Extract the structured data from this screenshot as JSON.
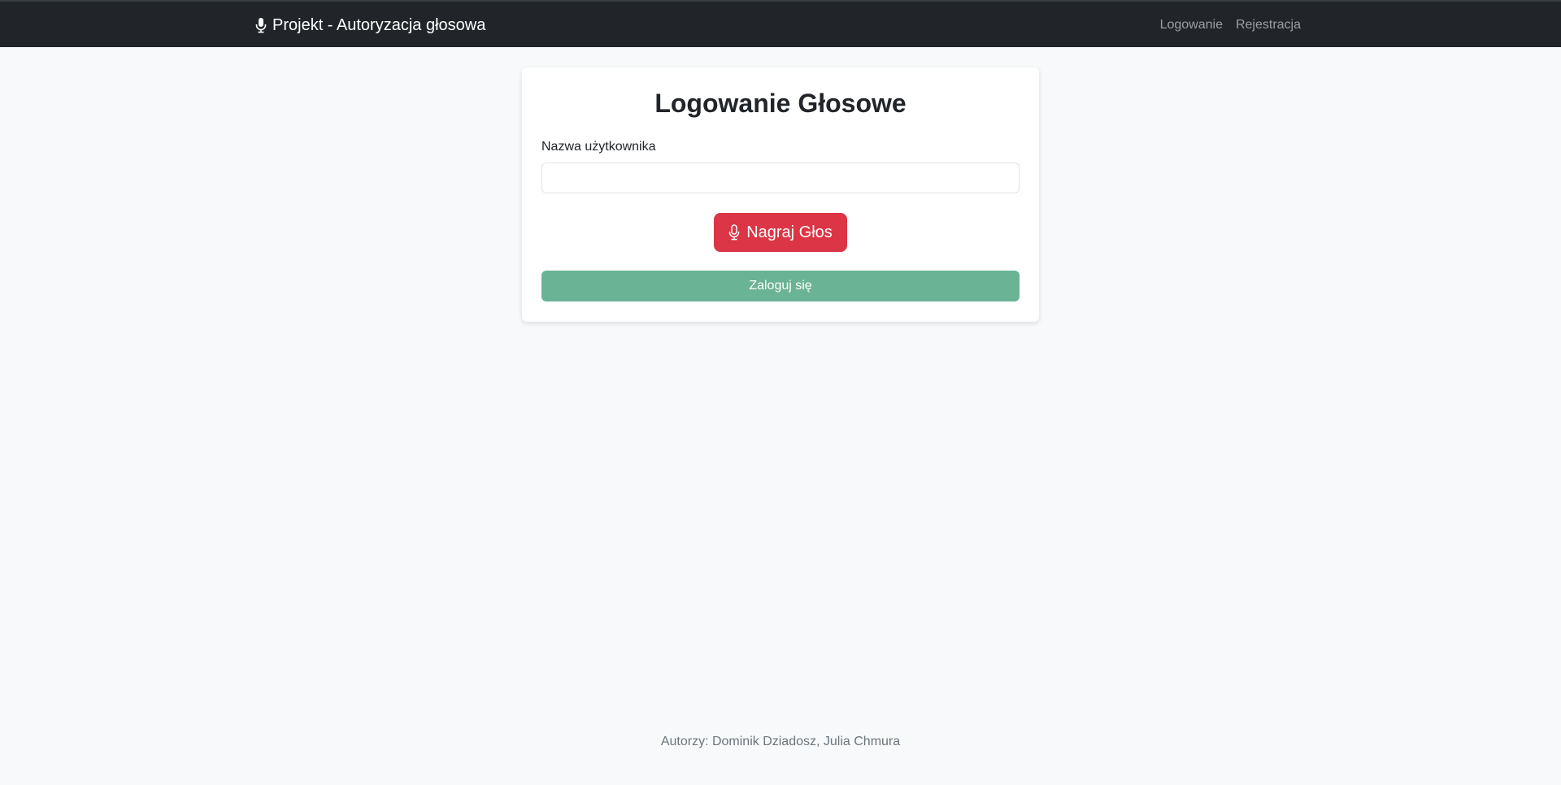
{
  "navbar": {
    "brand": {
      "icon": "microphone-icon",
      "label": "Projekt - Autoryzacja głosowa"
    },
    "links": [
      {
        "label": "Logowanie"
      },
      {
        "label": "Rejestracja"
      }
    ]
  },
  "login_card": {
    "title": "Logowanie Głosowe",
    "username_label": "Nazwa użytkownika",
    "username_value": "",
    "username_placeholder": "",
    "record_button": {
      "icon": "microphone-icon",
      "label": "Nagraj Głos"
    },
    "submit_button": {
      "label": "Zaloguj się"
    }
  },
  "footer": {
    "text": "Autorzy: Dominik Dziadosz, Julia Chmura"
  },
  "colors": {
    "navbar_bg": "#212529",
    "page_bg": "#f8f9fa",
    "record_button": "#dc3545",
    "submit_button": "#6ab394"
  }
}
